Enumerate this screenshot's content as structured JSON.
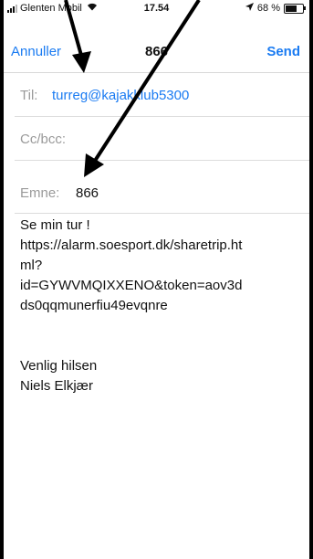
{
  "status_bar": {
    "carrier": "Glenten Mobil",
    "time": "17.54",
    "battery": "68 %",
    "battery_level": 0.68,
    "icons": [
      "signal-icon",
      "wifi-icon",
      "location-icon",
      "battery-icon"
    ]
  },
  "nav": {
    "cancel_label": "Annuller",
    "title": "866",
    "send_label": "Send"
  },
  "fields": {
    "to_label": "Til:",
    "to_value": "turreg@kajakklub5300",
    "cc_label": "Cc/bcc:",
    "subject_label": "Emne:",
    "subject_value": "866"
  },
  "body": {
    "line1": "Se min tur !",
    "line2": "https://alarm.soesport.dk/sharetrip.ht",
    "line3": "ml?",
    "line4": "id=GYWVMQIXXENO&token=aov3d",
    "line5": "ds0qqmunerfiu49evqnre",
    "sign1": "Venlig hilsen",
    "sign2": "Niels Elkjær"
  },
  "colors": {
    "accent": "#1a7bf2",
    "placeholder": "#9a9a9a",
    "arrow": "#000000"
  }
}
